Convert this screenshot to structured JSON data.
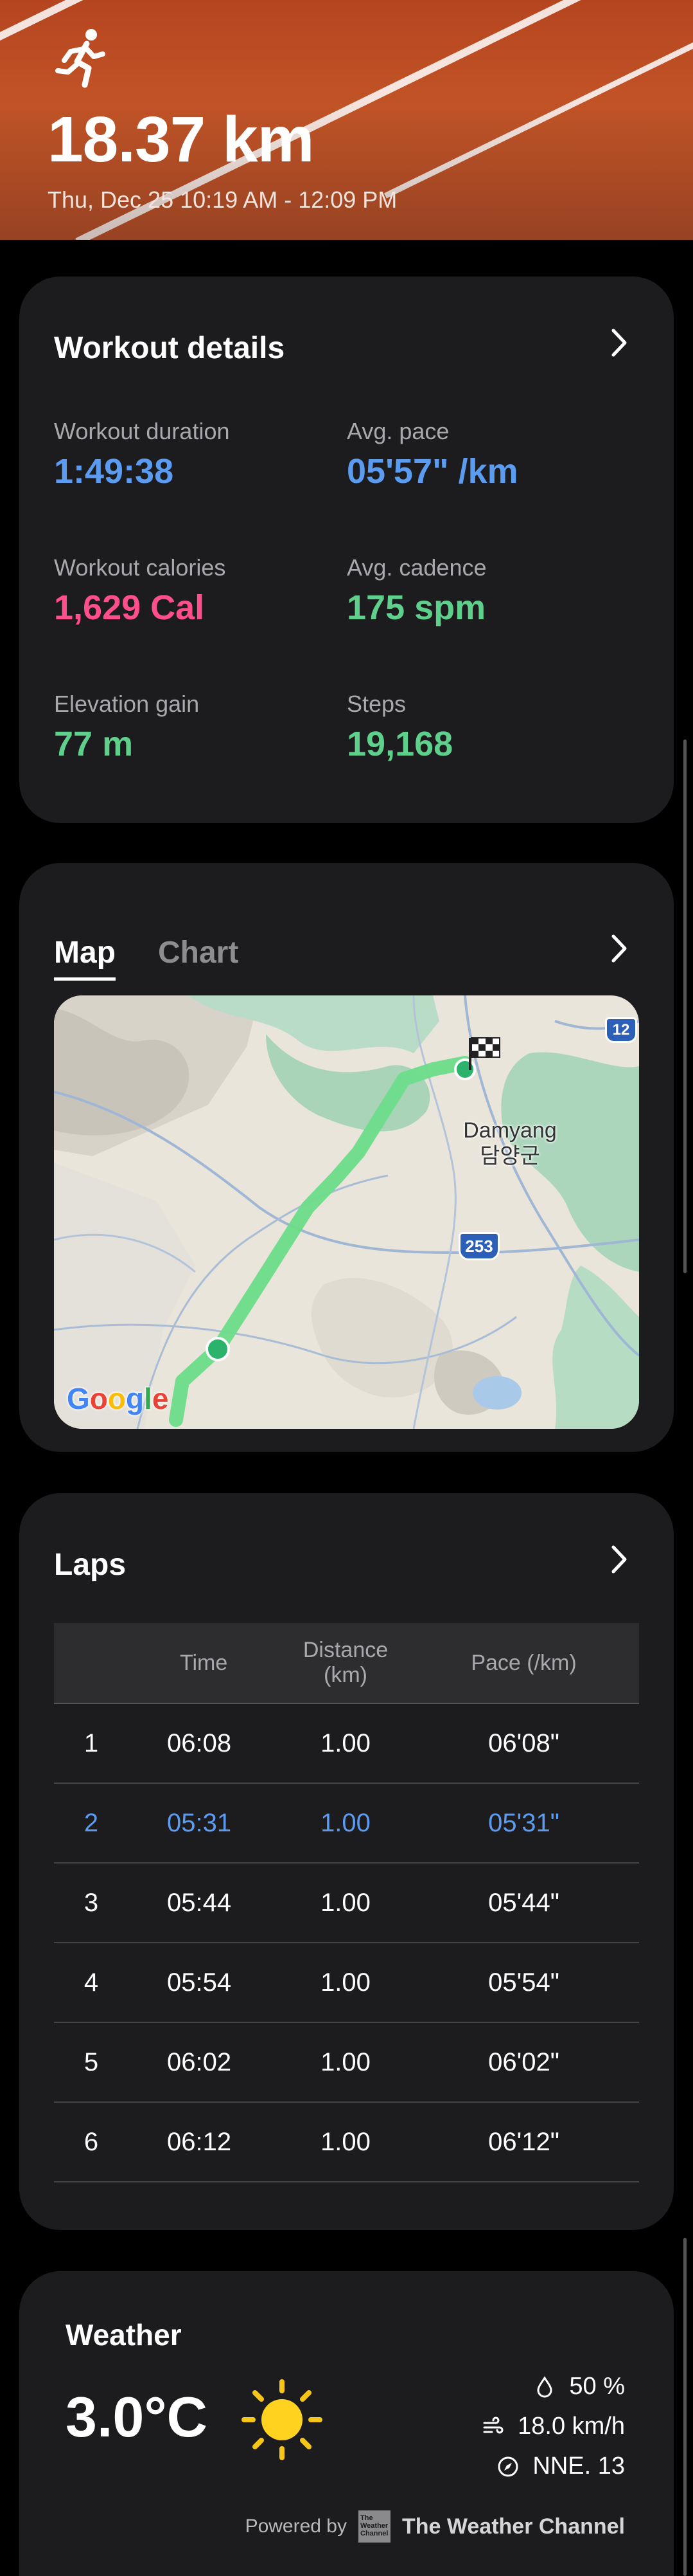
{
  "header": {
    "activity_icon": "running-person-icon",
    "distance": "18.37 km",
    "datetime": "Thu, Dec 25 10:19 AM - 12:09 PM"
  },
  "workout_details": {
    "title": "Workout details",
    "duration_label": "Workout duration",
    "duration_value": "1:49:38",
    "pace_label": "Avg. pace",
    "pace_value": "05'57\" /km",
    "calories_label": "Workout calories",
    "calories_value": "1,629 Cal",
    "cadence_label": "Avg. cadence",
    "cadence_value": "175 spm",
    "elevation_label": "Elevation gain",
    "elevation_value": "77 m",
    "steps_label": "Steps",
    "steps_value": "19,168"
  },
  "route": {
    "tabs": [
      {
        "label": "Map",
        "active": true
      },
      {
        "label": "Chart",
        "active": false
      }
    ],
    "map": {
      "place_name": "Damyang",
      "place_name_local": "담양군",
      "road_shields": [
        "12",
        "253"
      ],
      "logo": "Google"
    }
  },
  "laps": {
    "title": "Laps",
    "columns": [
      "",
      "Time",
      "Distance (km)",
      "Pace (/km)"
    ],
    "rows": [
      [
        "1",
        "06:08",
        "1.00",
        "06'08\""
      ],
      [
        "2",
        "05:31",
        "1.00",
        "05'31\""
      ],
      [
        "3",
        "05:44",
        "1.00",
        "05'44\""
      ],
      [
        "4",
        "05:54",
        "1.00",
        "05'54\""
      ],
      [
        "5",
        "06:02",
        "1.00",
        "06'02\""
      ],
      [
        "6",
        "06:12",
        "1.00",
        "06'12\""
      ]
    ],
    "highlighted_row": 2
  },
  "weather": {
    "title": "Weather",
    "temperature": "3.0°C",
    "condition_icon": "sun-icon",
    "humidity": "50 %",
    "wind_speed": "18.0 km/h",
    "wind_direction": "NNE. 13",
    "powered_by": "Powered by",
    "provider": "The Weather Channel",
    "provider_box": "The Weather Channel"
  },
  "colors": {
    "accent_blue": "#5b9bf0",
    "calories_pink": "#ff4f8b",
    "metric_green": "#5fd08c",
    "card_bg": "#1c1c1e",
    "route_green": "#6ddc8a"
  }
}
